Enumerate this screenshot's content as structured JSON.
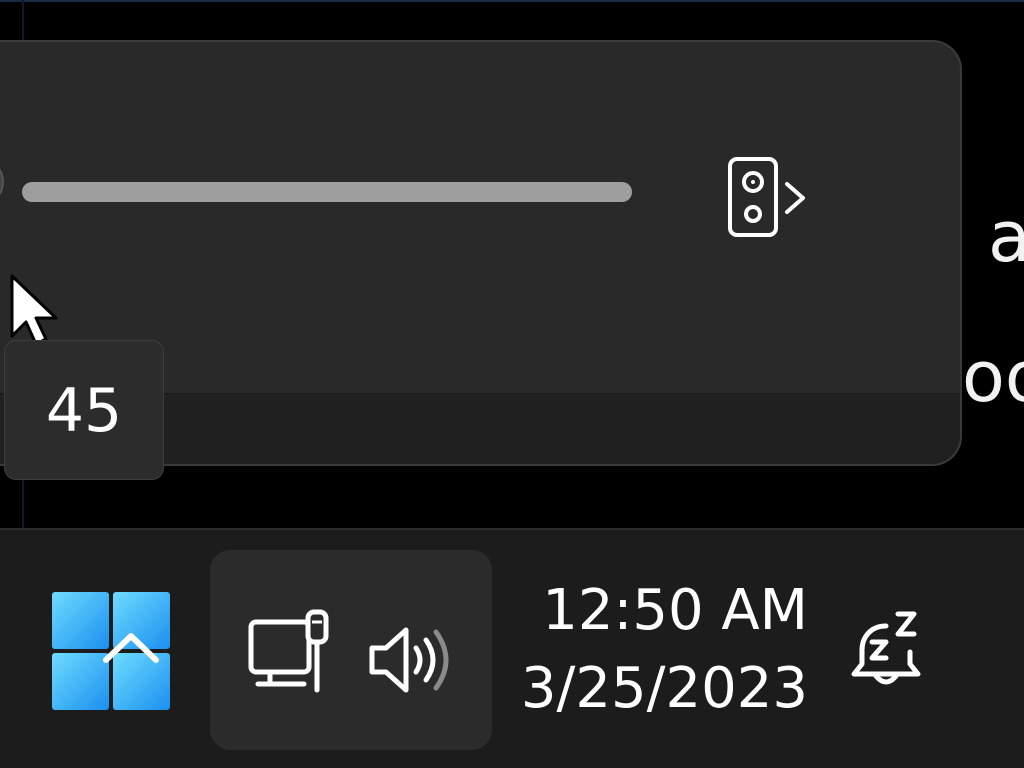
{
  "background": {
    "line1": "a",
    "line2": "oo"
  },
  "volume_flyout": {
    "volume_level": 45,
    "tooltip_value": "45",
    "output_device_icon": "speaker-icon",
    "chevron_icon": "chevron-right-icon"
  },
  "taskbar": {
    "start_icon": "windows-logo-icon",
    "overflow_icon": "chevron-up-icon",
    "network_icon": "ethernet-monitor-icon",
    "volume_icon": "speaker-volume-icon",
    "time": "12:50 AM",
    "date": "3/25/2023",
    "notification_icon": "snooze-bell-icon"
  },
  "colors": {
    "accent": "#4cc2ff",
    "thumb": "#54b2ef",
    "track": "#9e9e9e",
    "flyout": "#292929",
    "taskbar": "#1c1c1c"
  }
}
